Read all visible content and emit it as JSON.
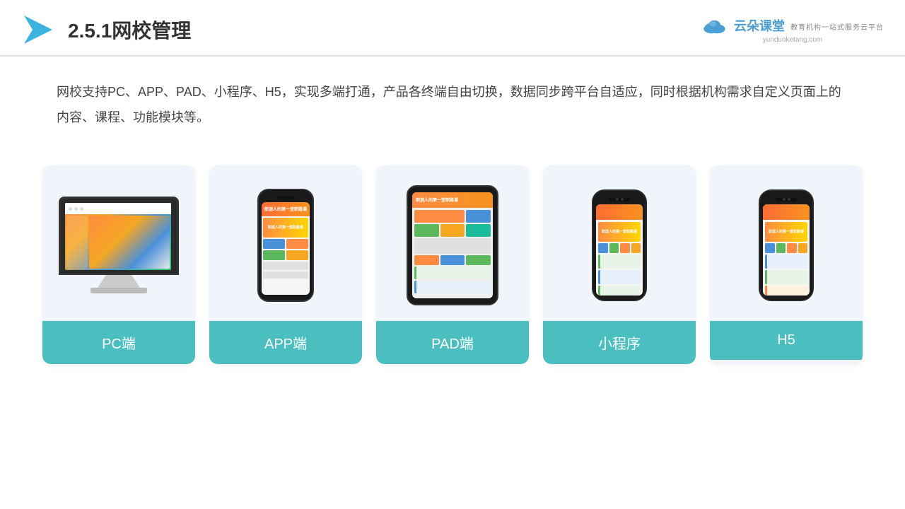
{
  "header": {
    "title": "2.5.1网校管理",
    "brand": {
      "name": "云朵课堂",
      "tagline": "教育机构一站式服务云平台",
      "url": "yunduoketang.com"
    }
  },
  "description": {
    "text": "网校支持PC、APP、PAD、小程序、H5，实现多端打通，产品各终端自由切换，数据同步跨平台自适应，同时根据机构需求自定义页面上的内容、课程、功能模块等。"
  },
  "cards": [
    {
      "id": "pc",
      "label": "PC端"
    },
    {
      "id": "app",
      "label": "APP端"
    },
    {
      "id": "pad",
      "label": "PAD端"
    },
    {
      "id": "miniprogram",
      "label": "小程序"
    },
    {
      "id": "h5",
      "label": "H5"
    }
  ]
}
